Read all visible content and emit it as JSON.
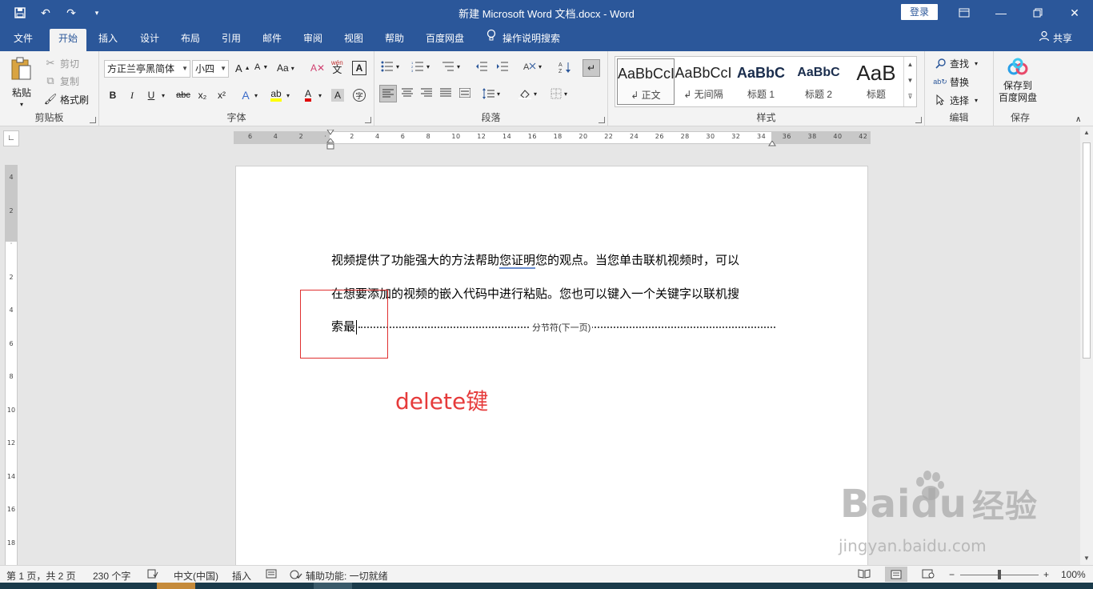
{
  "window": {
    "title": "新建 Microsoft Word 文档.docx  -  Word",
    "login_label": "登录"
  },
  "tabs": [
    "文件",
    "开始",
    "插入",
    "设计",
    "布局",
    "引用",
    "邮件",
    "审阅",
    "视图",
    "帮助",
    "百度网盘"
  ],
  "active_tab": "开始",
  "tell_me": "操作说明搜索",
  "share_label": "共享",
  "clipboard": {
    "paste": "粘贴",
    "cut": "剪切",
    "copy": "复制",
    "format_painter": "格式刷",
    "group_label": "剪贴板"
  },
  "font": {
    "font_name": "方正兰亭黑简体",
    "font_size": "小四",
    "group_label": "字体",
    "case_label": "Aa",
    "bold": "B",
    "italic": "I",
    "underline": "U",
    "strikethrough": "abc",
    "subscript": "x₂",
    "superscript": "x²",
    "font_color_label": "A",
    "pinyin_label": "wén"
  },
  "paragraph": {
    "group_label": "段落"
  },
  "styles": {
    "group_label": "样式",
    "items": [
      {
        "sample": "AaBbCcI",
        "name": "↲ 正文"
      },
      {
        "sample": "AaBbCcI",
        "name": "↲ 无间隔"
      },
      {
        "sample": "AaBbC",
        "name": "标题 1"
      },
      {
        "sample": "AaBbC",
        "name": "标题 2"
      },
      {
        "sample": "AaB",
        "name": "标题"
      }
    ]
  },
  "editing": {
    "find": "查找",
    "replace": "替换",
    "select": "选择",
    "group_label": "编辑"
  },
  "save": {
    "line1": "保存到",
    "line2": "百度网盘",
    "group_label": "保存"
  },
  "ruler": {
    "h_labels": [
      "6",
      "4",
      "2",
      "",
      "2",
      "4",
      "6",
      "8",
      "10",
      "12",
      "14",
      "16",
      "18",
      "20",
      "22",
      "24",
      "26",
      "28",
      "30",
      "32",
      "34",
      "36",
      "38",
      "40",
      "42"
    ],
    "v_labels": [
      "4",
      "2",
      "",
      "2",
      "4",
      "6",
      "8",
      "10",
      "12",
      "14",
      "16",
      "18"
    ]
  },
  "document": {
    "line1_a": "视频提供了功能强大的方法帮助",
    "line1_b": "您证明",
    "line1_c": "您的观点。当您单击联机视频时，可以",
    "line2": "在想要添加的视频的嵌入代码中进行粘贴。您也可以键入一个关键字以联机搜",
    "line3": "索最",
    "section_break": "分节符(下一页)"
  },
  "annotation": "delete键",
  "status": {
    "page": "第 1 页，共 2 页",
    "words": "230 个字",
    "language": "中文(中国)",
    "mode": "插入",
    "accessibility": "辅助功能: 一切就绪",
    "zoom": "100%"
  },
  "watermark": {
    "brand": "Bai",
    "brand2": "du",
    "suffix": "经验",
    "url": "jingyan.baidu.com"
  },
  "colors": {
    "title_bar": "#2b579a",
    "annotation": "#e63b3b",
    "highlight": "#ffff00",
    "font_color": "#e00000"
  }
}
